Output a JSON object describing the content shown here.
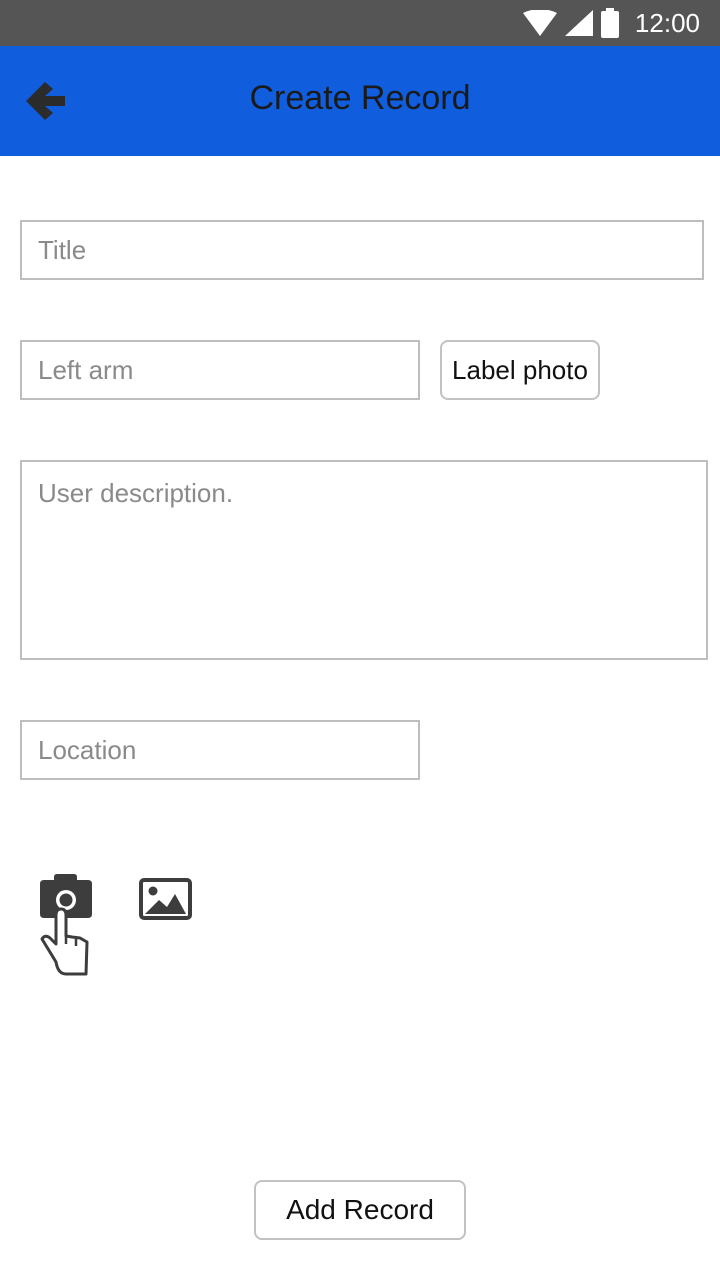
{
  "status_bar": {
    "time": "12:00",
    "icons": [
      "wifi-icon",
      "cell-signal-icon",
      "battery-icon"
    ]
  },
  "app_bar": {
    "title": "Create Record",
    "back_icon": "arrow-left-icon",
    "color": "#105ede"
  },
  "form": {
    "title": {
      "placeholder": "Title",
      "value": ""
    },
    "body_part": {
      "placeholder": "Left arm",
      "value": ""
    },
    "label_photo_button": "Label photo",
    "description": {
      "placeholder": "User description.",
      "value": ""
    },
    "location": {
      "placeholder": "Location",
      "value": ""
    }
  },
  "media": {
    "camera_icon": "camera-icon",
    "touch_icon": "pointing-hand-icon",
    "gallery_icon": "image-gallery-icon"
  },
  "actions": {
    "add_record_label": "Add Record"
  }
}
